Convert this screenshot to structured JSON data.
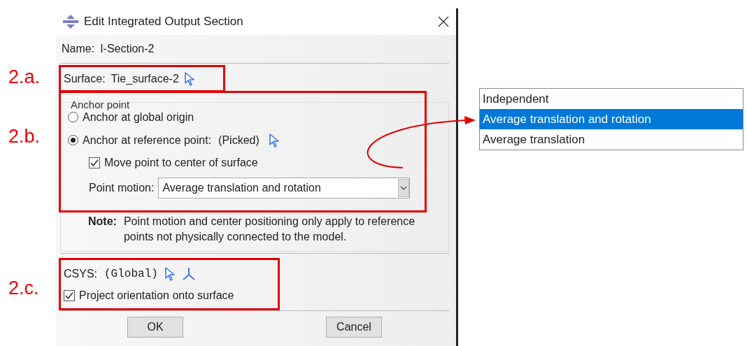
{
  "window": {
    "title": "Edit Integrated Output Section"
  },
  "name": {
    "label": "Name:",
    "value": "I-Section-2"
  },
  "surface": {
    "label": "Surface:",
    "value": "Tie_surface-2"
  },
  "anchor_point": {
    "title": "Anchor point",
    "options": [
      {
        "label": "Anchor at global origin",
        "selected": false
      },
      {
        "label": "Anchor at reference point:",
        "value": "(Picked)",
        "selected": true
      }
    ],
    "move_to_center": {
      "label": "Move point to center of surface",
      "checked": true
    },
    "point_motion": {
      "label": "Point motion:",
      "value": "Average translation and rotation"
    },
    "note": {
      "label": "Note:",
      "text": "Point motion and center positioning only apply to reference points not physically connected to the model."
    }
  },
  "csys": {
    "label": "CSYS:",
    "value": "(Global)"
  },
  "project_orientation": {
    "label": "Project orientation onto surface",
    "checked": true
  },
  "buttons": [
    "OK",
    "Cancel"
  ],
  "annotations": [
    "2.a.",
    "2.b.",
    "2.c."
  ],
  "dropdown_list": {
    "items": [
      {
        "label": "Independent",
        "selected": false
      },
      {
        "label": "Average translation and rotation",
        "selected": true
      },
      {
        "label": "Average translation",
        "selected": false
      }
    ]
  }
}
